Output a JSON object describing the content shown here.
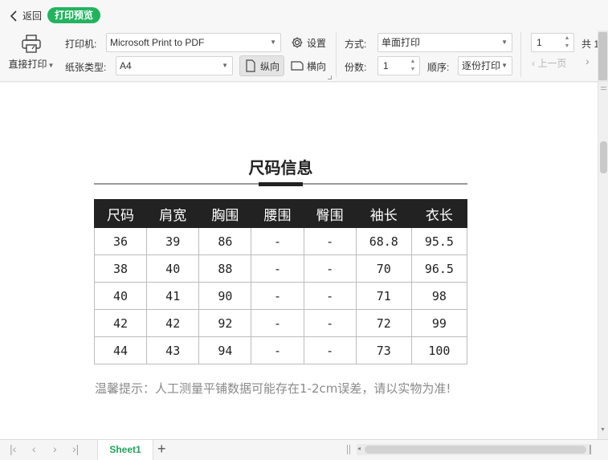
{
  "toolbar": {
    "back_label": "返回",
    "mode_label": "打印预览",
    "direct_print_label": "直接打印",
    "printer_label": "打印机:",
    "printer_value": "Microsoft Print to PDF",
    "settings_label": "设置",
    "paper_label": "纸张类型:",
    "paper_value": "A4",
    "portrait_label": "纵向",
    "landscape_label": "横向",
    "method_label": "方式:",
    "method_value": "单面打印",
    "copies_label": "份数:",
    "copies_value": "1",
    "order_label": "顺序:",
    "order_value": "逐份打印",
    "page_value": "1",
    "total_label": "共 1",
    "prev_page_label": "上一页"
  },
  "document": {
    "title": "尺码信息",
    "table": {
      "headers": [
        "尺码",
        "肩宽",
        "胸围",
        "腰围",
        "臀围",
        "袖长",
        "衣长"
      ],
      "rows": [
        [
          "36",
          "39",
          "86",
          "-",
          "-",
          "68.8",
          "95.5"
        ],
        [
          "38",
          "40",
          "88",
          "-",
          "-",
          "70",
          "96.5"
        ],
        [
          "40",
          "41",
          "90",
          "-",
          "-",
          "71",
          "98"
        ],
        [
          "42",
          "42",
          "92",
          "-",
          "-",
          "72",
          "99"
        ],
        [
          "44",
          "43",
          "94",
          "-",
          "-",
          "73",
          "100"
        ]
      ]
    },
    "tip": "温馨提示：人工测量平铺数据可能存在1-2cm误差，请以实物为准!"
  },
  "sheets": {
    "active_tab": "Sheet1"
  },
  "colors": {
    "accent": "#22b35e",
    "header_bg": "#222222"
  }
}
